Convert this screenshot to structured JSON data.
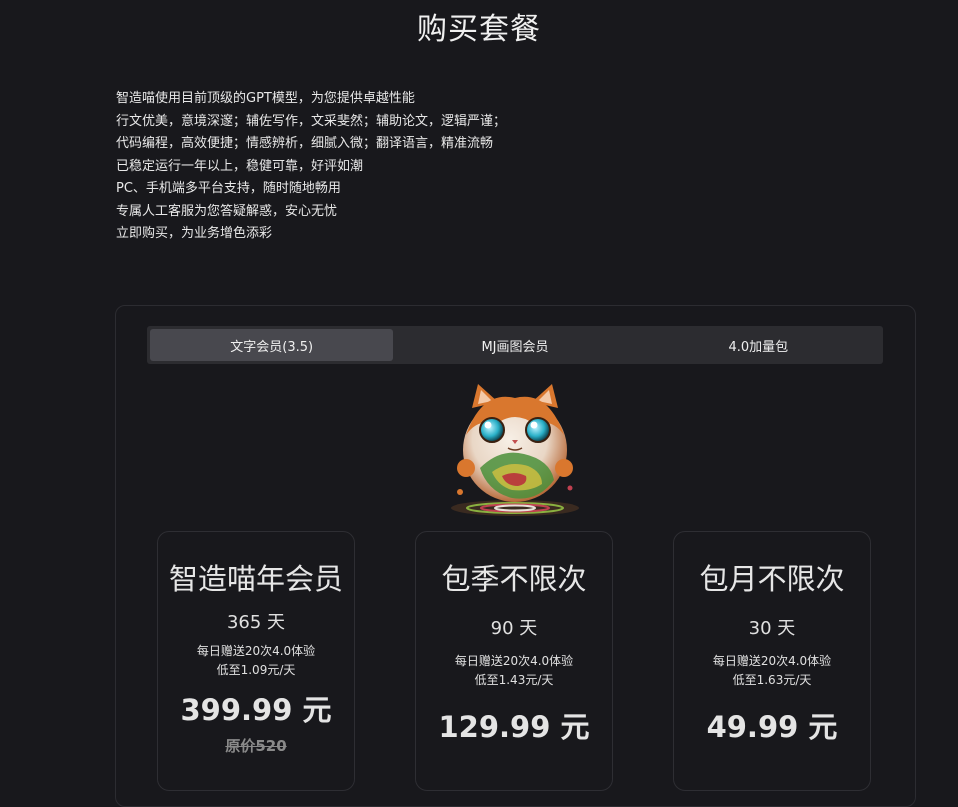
{
  "page": {
    "title": "购买套餐"
  },
  "intro": {
    "lines": [
      "智造喵使用目前顶级的GPT模型，为您提供卓越性能",
      "行文优美，意境深邃；辅佐写作，文采斐然；辅助论文，逻辑严谨；",
      "代码编程，高效便捷；情感辨析，细腻入微；翻译语言，精准流畅",
      "已稳定运行一年以上，稳健可靠，好评如潮",
      "PC、手机端多平台支持，随时随地畅用",
      "专属人工客服为您答疑解惑，安心无忧",
      "立即购买，为业务增色添彩"
    ]
  },
  "tabs": [
    {
      "label": "文字会员(3.5)",
      "active": true
    },
    {
      "label": "MJ画图会员",
      "active": false
    },
    {
      "label": "4.0加量包",
      "active": false
    }
  ],
  "mascot": {
    "icon": "cat-mascot-icon"
  },
  "plans": [
    {
      "name": "智造喵年会员",
      "days": "365 天",
      "notes": [
        "每日赠送20次4.0体验",
        "低至1.09元/天"
      ],
      "price": "399.99 元",
      "original_price": "原价520"
    },
    {
      "name": "包季不限次",
      "days": "90 天",
      "notes": [
        "每日赠送20次4.0体验",
        "低至1.43元/天"
      ],
      "price": "129.99 元"
    },
    {
      "name": "包月不限次",
      "days": "30 天",
      "notes": [
        "每日赠送20次4.0体验",
        "低至1.63元/天"
      ],
      "price": "49.99 元"
    }
  ],
  "colors": {
    "background": "#18181c",
    "tab_bar": "#2c2c30",
    "tab_active": "#48484e",
    "card_border": "#2e2e33"
  }
}
